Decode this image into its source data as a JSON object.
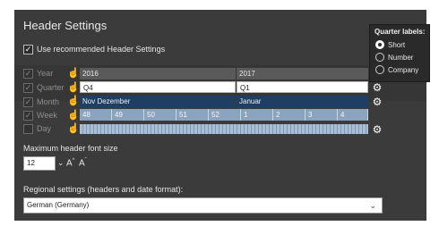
{
  "title": "Header Settings",
  "use_recommended": {
    "label": "Use recommended Header Settings",
    "checked": true
  },
  "rows": [
    {
      "label": "Year",
      "checked": true,
      "dimmed": true
    },
    {
      "label": "Quarter",
      "checked": true,
      "dimmed": true
    },
    {
      "label": "Month",
      "checked": true,
      "dimmed": true
    },
    {
      "label": "Week",
      "checked": true,
      "dimmed": true
    },
    {
      "label": "Day",
      "checked": false,
      "dimmed": true
    }
  ],
  "timeline": {
    "years": [
      "2016",
      "2017"
    ],
    "quarters": [
      "Q4",
      "Q1"
    ],
    "months": [
      "Nov Dezember",
      "Januar"
    ],
    "weeks": [
      "48",
      "49",
      "50",
      "51",
      "52",
      "1",
      "2",
      "3",
      "4"
    ]
  },
  "icons": {
    "drag": "hand-drag-icon",
    "gear": "gear-icon",
    "caret": "chevron-down-icon",
    "checkmark": "✓",
    "increase_font": "A",
    "decrease_font": "A"
  },
  "font_size": {
    "label": "Maximum header font size",
    "value": "12"
  },
  "regional": {
    "label": "Regional settings (headers and date format):",
    "value": "German (Germany)"
  },
  "quarter_popup": {
    "title": "Quarter labels:",
    "options": [
      "Short",
      "Number",
      "Company"
    ],
    "selected": "Short"
  },
  "colors": {
    "panel": "#3b3b3b",
    "year_band": "#5a5a5a",
    "month_band": "#1f3e64",
    "week_band": "#8aa3bf"
  }
}
